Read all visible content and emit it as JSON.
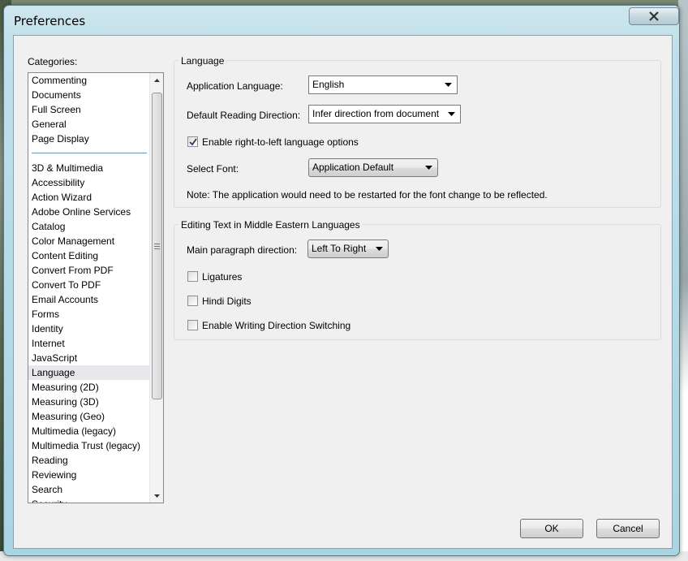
{
  "window": {
    "title": "Preferences"
  },
  "categories": {
    "label": "Categories:",
    "top_items": [
      "Commenting",
      "Documents",
      "Full Screen",
      "General",
      "Page Display"
    ],
    "items": [
      "3D & Multimedia",
      "Accessibility",
      "Action Wizard",
      "Adobe Online Services",
      "Catalog",
      "Color Management",
      "Content Editing",
      "Convert From PDF",
      "Convert To PDF",
      "Email Accounts",
      "Forms",
      "Identity",
      "Internet",
      "JavaScript",
      "Language",
      "Measuring (2D)",
      "Measuring (3D)",
      "Measuring (Geo)",
      "Multimedia (legacy)",
      "Multimedia Trust (legacy)",
      "Reading",
      "Reviewing",
      "Search",
      "Security"
    ],
    "selected": "Language"
  },
  "language_group": {
    "title": "Language",
    "app_language_label": "Application Language:",
    "app_language_value": "English",
    "reading_direction_label": "Default Reading Direction:",
    "reading_direction_value": "Infer direction from document",
    "rtl_checkbox_label": "Enable right-to-left language options",
    "rtl_checked": true,
    "select_font_label": "Select Font:",
    "select_font_value": "Application Default",
    "note": "Note: The application would need to be restarted for the font change to be reflected."
  },
  "middle_eastern_group": {
    "title": "Editing Text in Middle Eastern Languages",
    "paragraph_direction_label": "Main paragraph direction:",
    "paragraph_direction_value": "Left To Right",
    "ligatures_label": "Ligatures",
    "hindi_digits_label": "Hindi Digits",
    "writing_direction_label": "Enable Writing Direction Switching"
  },
  "buttons": {
    "ok": "OK",
    "cancel": "Cancel"
  },
  "icons": [
    "close-icon",
    "checkmark-icon",
    "dropdown-arrow-icon",
    "scroll-up-icon",
    "scroll-down-icon"
  ]
}
